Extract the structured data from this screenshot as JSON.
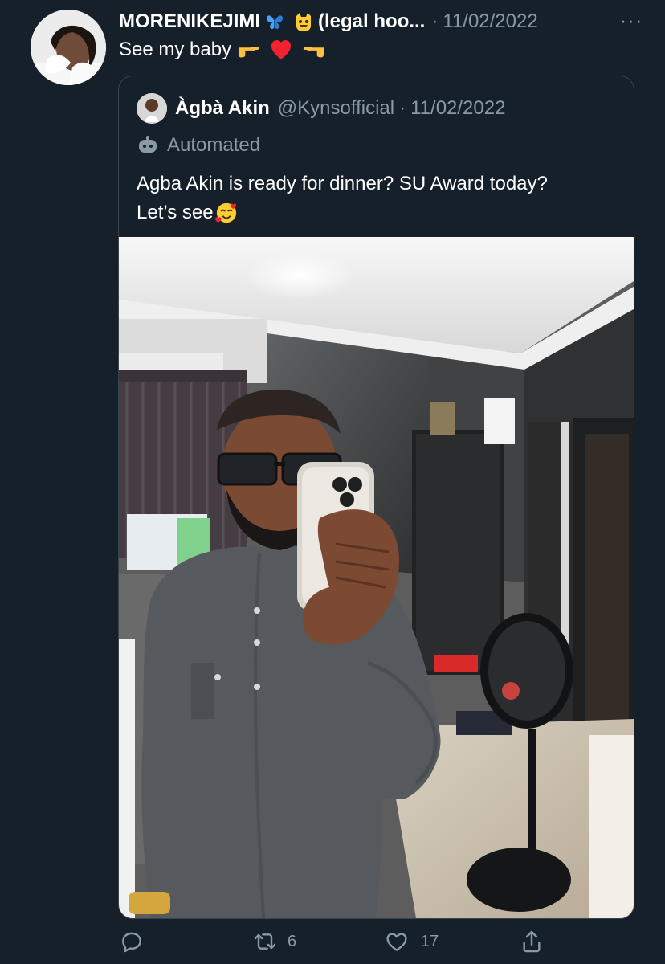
{
  "tweet": {
    "author_name": "MORENIKEJIMI",
    "author_badge_text": "(legal hoo...",
    "separator": "·",
    "date": "11/02/2022",
    "text": "See my baby",
    "more_label": "···",
    "reactions": {
      "retweets": "6",
      "likes": "17"
    }
  },
  "quoted": {
    "author_name": "Àgbà Akin",
    "handle": "@Kynsofficial",
    "separator": "·",
    "date": "11/02/2022",
    "automated_label": "Automated",
    "text_line1": "Agba Akin is ready for dinner? SU Award today?",
    "text_line2": "Let’s see"
  },
  "icons": {
    "reply": "reply-icon",
    "retweet": "retweet-icon",
    "like": "heart-icon",
    "share": "share-icon",
    "butterfly": "butterfly-icon",
    "smiling_cat": "smiling-cat-icon",
    "pointing_right": "point-right-icon",
    "heart": "red-heart-icon",
    "pointing_left": "point-left-icon",
    "robot": "robot-icon",
    "smiling_face": "smiling-face-with-hearts-icon"
  },
  "colors": {
    "background": "#15202b",
    "text": "#ffffff",
    "muted": "#8b98a5",
    "border": "#38444d",
    "heart": "#f4212e"
  }
}
